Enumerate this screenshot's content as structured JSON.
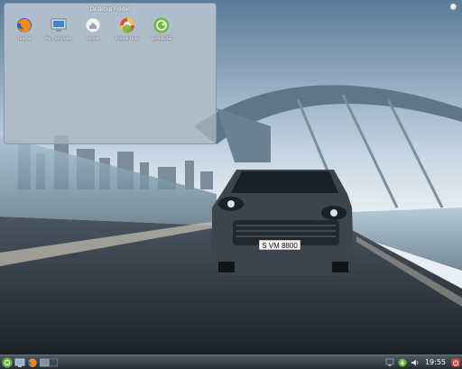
{
  "desktop": {
    "wallpaper": "porsche-cayenne-on-bridge",
    "car_plate": "S VM 8800"
  },
  "folder_view": {
    "title": "Desktop Folder",
    "icons": [
      {
        "label": "Firefox",
        "icon": "firefox-icon"
      },
      {
        "label": "My Computer",
        "icon": "computer-icon"
      },
      {
        "label": "Home",
        "icon": "home-icon"
      },
      {
        "label": "Online Help",
        "icon": "lifebuoy-icon"
      },
      {
        "label": "openSUSE",
        "icon": "opensuse-icon"
      }
    ]
  },
  "panel": {
    "launchers": [
      "start-menu-icon",
      "show-desktop-icon",
      "firefox-icon",
      "pager-icon"
    ],
    "tray": [
      "network-icon",
      "updater-icon",
      "volume-icon"
    ],
    "clock": "19:55",
    "colors": {
      "panel_top": "#4f5a63",
      "panel_bottom": "#262d33",
      "start": "#6aba3c",
      "power": "#e04a3a"
    }
  }
}
